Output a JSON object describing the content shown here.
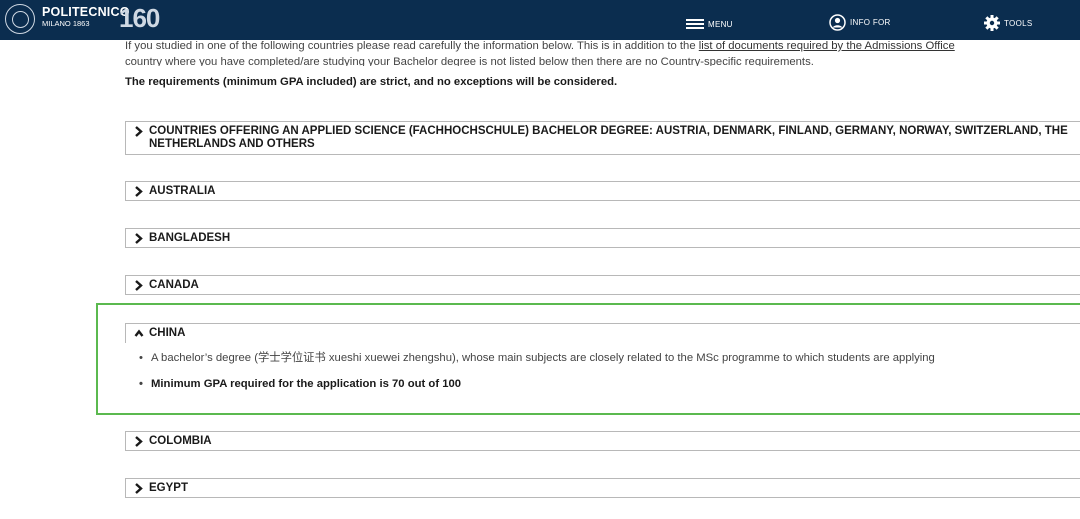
{
  "header": {
    "brand_name": "POLITECNICO",
    "brand_sub": "MILANO 1863",
    "brand_160": "160",
    "nav": [
      {
        "label": "MENU",
        "icon": "hamburger-icon"
      },
      {
        "label": "INFO FOR",
        "icon": "user-circle-icon"
      },
      {
        "label": "TOOLS",
        "icon": "gear-icon"
      }
    ],
    "colors": {
      "bar": "#0b2d4f",
      "highlight": "#5bb94f"
    }
  },
  "intro": {
    "line1_before": "If you studied in one of the following countries please read carefully the information below. This is in addition to the ",
    "line1_link": "list of documents required by the Admissions Office",
    "line2": "country where you have completed/are studying your Bachelor degree is not listed below then there are no Country-specific requirements.",
    "strict": "The requirements (minimum GPA included) are strict, and no exceptions will be considered."
  },
  "accordion": [
    {
      "title": "COUNTRIES OFFERING AN APPLIED SCIENCE (FACHHOCHSCHULE) BACHELOR DEGREE: AUSTRIA, DENMARK, FINLAND, GERMANY, NORWAY, SWITZERLAND, THE NETHERLANDS AND OTHERS",
      "expanded": false
    },
    {
      "title": "AUSTRALIA",
      "expanded": false
    },
    {
      "title": "BANGLADESH",
      "expanded": false
    },
    {
      "title": "CANADA",
      "expanded": false
    },
    {
      "title": "CHINA",
      "expanded": true
    },
    {
      "title": "COLOMBIA",
      "expanded": false
    },
    {
      "title": "EGYPT",
      "expanded": false
    }
  ],
  "china": {
    "items": [
      "A bachelor’s degree (学士学位证书 xueshi xuewei zhengshu), whose main subjects are closely related to the MSc programme to which students are applying",
      "Minimum GPA required for the application is 70 out of 100"
    ]
  }
}
